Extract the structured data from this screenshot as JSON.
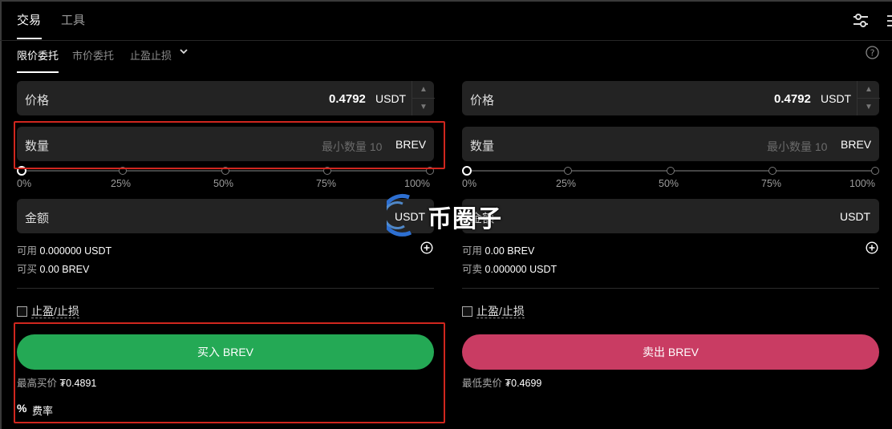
{
  "top_tabs": [
    {
      "label": "交易",
      "active": true
    },
    {
      "label": "工具",
      "active": false
    }
  ],
  "sub_tabs": [
    {
      "label": "限价委托",
      "active": true
    },
    {
      "label": "市价委托",
      "active": false
    },
    {
      "label": "止盈止损",
      "active": false
    }
  ],
  "buy_panel": {
    "price": {
      "label": "价格",
      "value": "0.4792",
      "unit": "USDT"
    },
    "quantity": {
      "label": "数量",
      "placeholder": "最小数量 10",
      "unit": "BREV"
    },
    "slider_labels": [
      "0%",
      "25%",
      "50%",
      "75%",
      "100%"
    ],
    "slider_value_pct": 0,
    "amount": {
      "label": "金额",
      "unit": "USDT"
    },
    "available_label": "可用",
    "available_value": "0.000000 USDT",
    "can_buy_label": "可买",
    "can_buy_value": "0.00 BREV",
    "tpsl_label": "止盈/止损",
    "action_label": "买入 BREV",
    "best_price_label": "最高买价",
    "best_price_value": "₮0.4891",
    "fee_icon": "%",
    "fee_label": "费率"
  },
  "sell_panel": {
    "price": {
      "label": "价格",
      "value": "0.4792",
      "unit": "USDT"
    },
    "quantity": {
      "label": "数量",
      "placeholder": "最小数量 10",
      "unit": "BREV"
    },
    "slider_labels": [
      "0%",
      "25%",
      "50%",
      "75%",
      "100%"
    ],
    "slider_value_pct": 0,
    "amount": {
      "label": "金额",
      "unit": "USDT"
    },
    "available_label": "可用",
    "available_value": "0.00 BREV",
    "can_sell_label": "可卖",
    "can_sell_value": "0.000000 USDT",
    "tpsl_label": "止盈/止损",
    "action_label": "卖出 BREV",
    "best_price_label": "最低卖价",
    "best_price_value": "₮0.4699"
  },
  "watermark": {
    "text": "币圈子"
  },
  "colors": {
    "buy": "#24a955",
    "sell": "#c93c63",
    "highlight": "#d0261e",
    "field_bg": "#232323"
  },
  "icons": [
    "settings-sliders-icon",
    "menu-icon",
    "chevron-down-icon",
    "help-icon",
    "plus-circle-icon",
    "percent-icon",
    "watermark-logo"
  ]
}
